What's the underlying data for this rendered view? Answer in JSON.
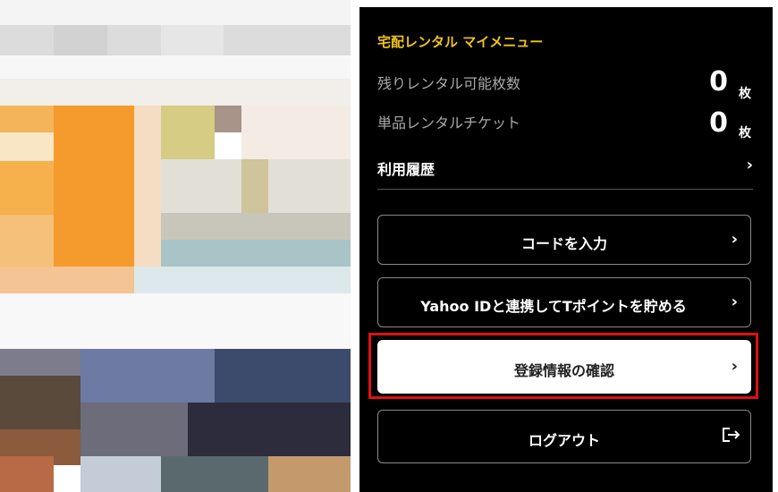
{
  "menu": {
    "title": "宅配レンタル マイメニュー",
    "remaining_rentals": {
      "label": "残りレンタル可能枚数",
      "value": "0",
      "unit": "枚"
    },
    "single_tickets": {
      "label": "単品レンタルチケット",
      "value": "0",
      "unit": "枚"
    },
    "history_label": "利用履歴",
    "buttons": [
      {
        "label": "コードを入力",
        "icon": "chevron-right-icon"
      },
      {
        "label": "Yahoo IDと連携してTポイントを貯める",
        "icon": "chevron-right-icon"
      },
      {
        "label": "登録情報の確認",
        "icon": "chevron-right-icon",
        "highlighted": true
      },
      {
        "label": "ログアウト",
        "icon": "logout-icon"
      }
    ],
    "colors": {
      "background": "#000000",
      "title": "#f2c418",
      "highlight": "#e01010"
    }
  }
}
